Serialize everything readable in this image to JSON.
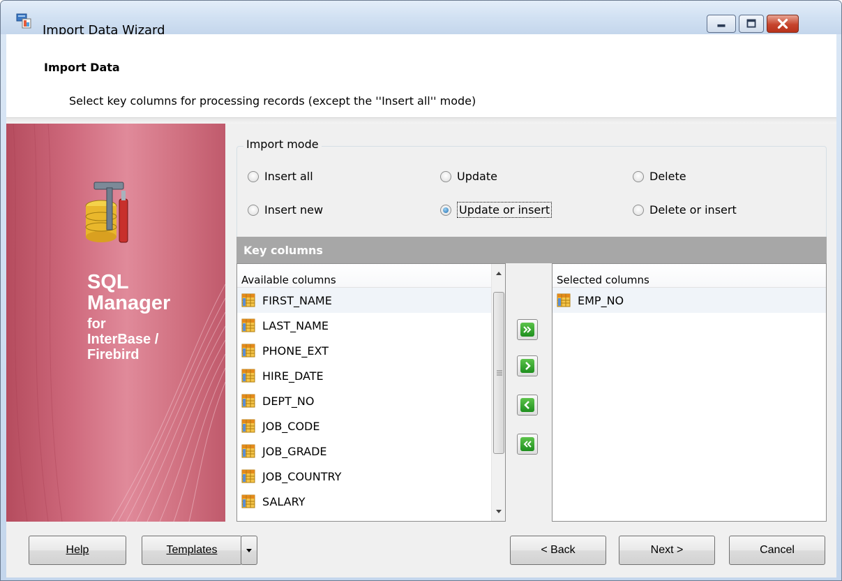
{
  "window": {
    "title": "Import Data Wizard"
  },
  "header": {
    "title": "Import Data",
    "subtitle": "Select key columns for processing records (except the ''Insert all'' mode)"
  },
  "banner": {
    "line1": "SQL",
    "line2": "Manager",
    "line3": "for",
    "line4": "InterBase /",
    "line5": "Firebird"
  },
  "import_mode": {
    "legend": "Import mode",
    "options": [
      "Insert all",
      "Update",
      "Delete",
      "Insert new",
      "Update or insert",
      "Delete or insert"
    ],
    "selected": "Update or insert"
  },
  "key_columns": {
    "header": "Key columns",
    "available": {
      "label": "Available columns",
      "items": [
        "FIRST_NAME",
        "LAST_NAME",
        "PHONE_EXT",
        "HIRE_DATE",
        "DEPT_NO",
        "JOB_CODE",
        "JOB_GRADE",
        "JOB_COUNTRY",
        "SALARY"
      ]
    },
    "selected_list": {
      "label": "Selected columns",
      "items": [
        "EMP_NO"
      ]
    },
    "move_buttons": [
      "add-all",
      "add-one",
      "remove-one",
      "remove-all"
    ]
  },
  "footer": {
    "help": "Help",
    "templates": "Templates",
    "back": "< Back",
    "next": "Next >",
    "cancel": "Cancel"
  },
  "colors": {
    "banner": "#cf6a7d",
    "key_header": "#a7a7a7",
    "move_button": "#2e9b2a",
    "close_button": "#c6452d"
  }
}
